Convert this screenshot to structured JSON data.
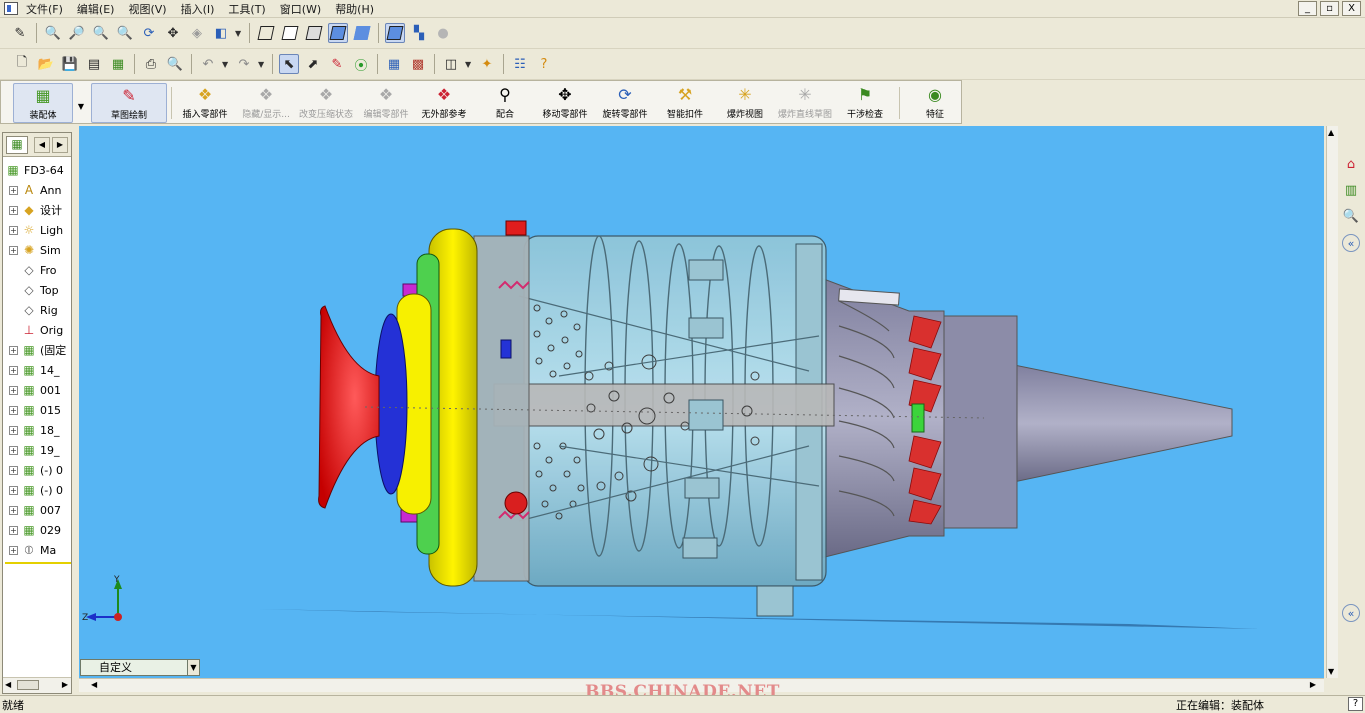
{
  "menubar": {
    "items": [
      "文件(F)",
      "编辑(E)",
      "视图(V)",
      "插入(I)",
      "工具(T)",
      "窗口(W)",
      "帮助(H)"
    ],
    "window_buttons": [
      "_",
      "▫",
      "X"
    ]
  },
  "command_manager": {
    "items": [
      {
        "label": "装配体",
        "icon": "assembly-icon",
        "enabled": true
      },
      {
        "label": "草图绘制",
        "icon": "sketch-icon",
        "enabled": true
      },
      {
        "label": "插入零部件",
        "icon": "insert-component-icon",
        "enabled": true
      },
      {
        "label": "隐藏/显示...",
        "icon": "hide-show-icon",
        "enabled": false
      },
      {
        "label": "改变压缩状态",
        "icon": "suppress-state-icon",
        "enabled": false
      },
      {
        "label": "编辑零部件",
        "icon": "edit-component-icon",
        "enabled": false
      },
      {
        "label": "无外部参考",
        "icon": "no-external-ref-icon",
        "enabled": true
      },
      {
        "label": "配合",
        "icon": "mate-icon",
        "enabled": true
      },
      {
        "label": "移动零部件",
        "icon": "move-component-icon",
        "enabled": true
      },
      {
        "label": "旋转零部件",
        "icon": "rotate-component-icon",
        "enabled": true
      },
      {
        "label": "智能扣件",
        "icon": "smart-fastener-icon",
        "enabled": true
      },
      {
        "label": "爆炸视图",
        "icon": "exploded-view-icon",
        "enabled": true
      },
      {
        "label": "爆炸直线草图",
        "icon": "explode-line-sketch-icon",
        "enabled": false
      },
      {
        "label": "干涉检查",
        "icon": "interference-check-icon",
        "enabled": true
      },
      {
        "label": "特征",
        "icon": "features-icon",
        "enabled": true
      }
    ]
  },
  "feature_tree": {
    "root": "FD3-64",
    "nodes": [
      {
        "label": "Ann",
        "icon": "annotations-icon",
        "expandable": true
      },
      {
        "label": "设计",
        "icon": "design-binder-icon",
        "expandable": true
      },
      {
        "label": "Ligh",
        "icon": "lights-icon",
        "expandable": true
      },
      {
        "label": "Sim",
        "icon": "simulation-icon",
        "expandable": true
      },
      {
        "label": "Fro",
        "icon": "plane-icon",
        "expandable": false
      },
      {
        "label": "Top",
        "icon": "plane-icon",
        "expandable": false
      },
      {
        "label": "Rig",
        "icon": "plane-icon",
        "expandable": false
      },
      {
        "label": "Orig",
        "icon": "origin-icon",
        "expandable": false
      },
      {
        "label": "(固定",
        "icon": "part-icon",
        "expandable": true
      },
      {
        "label": "14_",
        "icon": "part-icon",
        "expandable": true
      },
      {
        "label": "001",
        "icon": "part-icon",
        "expandable": true
      },
      {
        "label": "015",
        "icon": "part-icon",
        "expandable": true
      },
      {
        "label": "18_",
        "icon": "part-icon",
        "expandable": true
      },
      {
        "label": "19_",
        "icon": "part-icon",
        "expandable": true
      },
      {
        "label": "(-) 0",
        "icon": "part-icon",
        "expandable": true
      },
      {
        "label": "(-) 0",
        "icon": "part-icon",
        "expandable": true
      },
      {
        "label": "007",
        "icon": "part-icon",
        "expandable": true
      },
      {
        "label": "029",
        "icon": "part-icon",
        "expandable": true
      },
      {
        "label": "Ma",
        "icon": "mates-icon",
        "expandable": true
      }
    ]
  },
  "viewport": {
    "background": "#56b5f3",
    "triad_labels": {
      "x": "Z",
      "y": "Y"
    }
  },
  "config": {
    "value": "自定义"
  },
  "status": {
    "left": "就绪",
    "right": "正在编辑：装配体",
    "help": "?"
  },
  "watermark": "BBS.CHINADE.NET"
}
